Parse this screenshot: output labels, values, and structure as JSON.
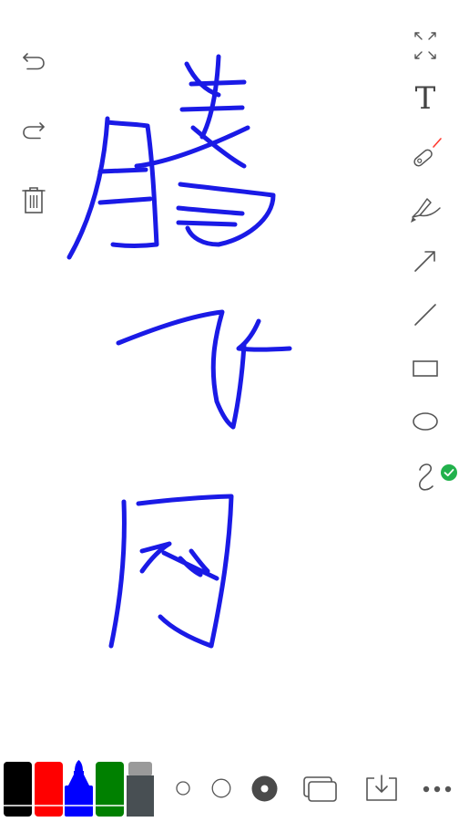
{
  "left_toolbar": {
    "undo_icon": "undo-arrow-icon",
    "redo_icon": "redo-arrow-icon",
    "delete_icon": "trash-icon"
  },
  "right_toolbar": {
    "items": [
      {
        "name": "fullscreen",
        "icon": "expand-icon"
      },
      {
        "name": "text",
        "icon": "text-icon",
        "label": "T"
      },
      {
        "name": "laser-pointer",
        "icon": "laser-pointer-icon"
      },
      {
        "name": "highlighter",
        "icon": "highlighter-icon"
      },
      {
        "name": "arrow",
        "icon": "arrow-icon"
      },
      {
        "name": "line",
        "icon": "line-icon"
      },
      {
        "name": "rectangle",
        "icon": "rectangle-icon"
      },
      {
        "name": "ellipse",
        "icon": "ellipse-icon"
      },
      {
        "name": "freehand",
        "icon": "freehand-icon",
        "selected": true
      }
    ],
    "selected_badge_color": "#22b14c"
  },
  "pen_colors": [
    {
      "name": "black",
      "color": "#000000"
    },
    {
      "name": "red",
      "color": "#ff0000"
    },
    {
      "name": "blue",
      "color": "#0000ff",
      "selected": true
    },
    {
      "name": "green",
      "color": "#008000"
    },
    {
      "name": "eraser",
      "color": "#484f53"
    }
  ],
  "stroke_sizes": [
    {
      "name": "small"
    },
    {
      "name": "medium"
    },
    {
      "name": "large",
      "selected": true
    }
  ],
  "bottom_actions": {
    "pages_icon": "pages-icon",
    "save_icon": "download-icon",
    "more_icon": "more-icon"
  },
  "ink_color": "#1a1ae6"
}
